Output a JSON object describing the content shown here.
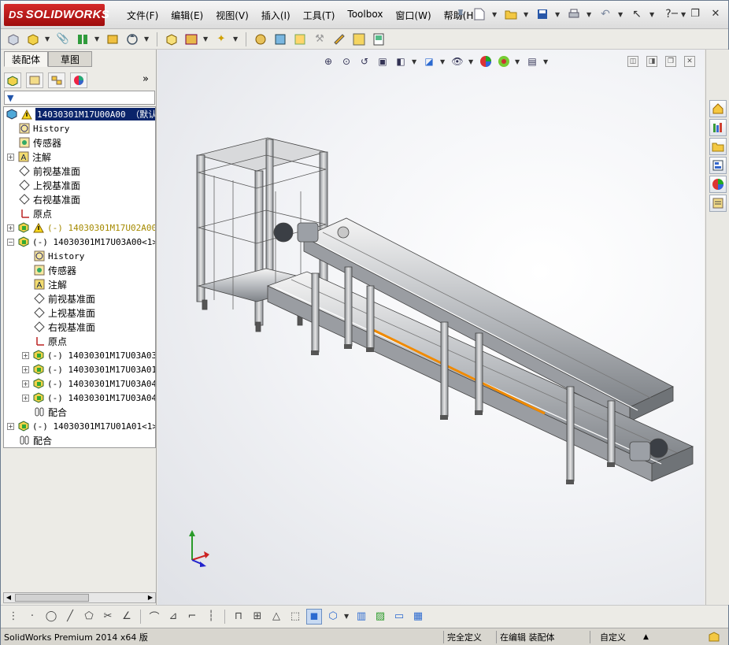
{
  "app": {
    "logo_text": "SOLIDWORKS",
    "logo_prefix": "DS"
  },
  "menu": [
    "文件(F)",
    "编辑(E)",
    "视图(V)",
    "插入(I)",
    "工具(T)",
    "Toolbox",
    "窗口(W)",
    "帮助(H)"
  ],
  "left_pane": {
    "tabs": [
      "装配体",
      "草图"
    ],
    "active_tab": "草图",
    "more_label": "»"
  },
  "tree": {
    "root": "14030301M17U00A00 （默认<",
    "items": {
      "history1": "History",
      "sensors1": "传感器",
      "annotations1": "注解",
      "front_plane1": "前视基准面",
      "top_plane1": "上视基准面",
      "right_plane1": "右视基准面",
      "origin1": "原点",
      "sub_u02": "(-) 14030301M17U02A00<1",
      "sub_u03": "(-) 14030301M17U03A00<1>",
      "history2": "History",
      "sensors2": "传感器",
      "annotations2": "注解",
      "front_plane2": "前视基准面",
      "top_plane2": "上视基准面",
      "right_plane2": "右视基准面",
      "origin2": "原点",
      "part_a03": "(-) 14030301M17U03A03<",
      "part_a01": "(-) 14030301M17U03A01<",
      "part_a04a": "(-) 14030301M17U03A04<",
      "part_a04b": "(-) 14030301M17U03A04<",
      "mates2": "配合",
      "sub_u01": "(-) 14030301M17U01A01<1>",
      "mates1": "配合"
    }
  },
  "status": {
    "product": "SolidWorks Premium 2014 x64 版",
    "definition": "完全定义",
    "editing": "在编辑 装配体",
    "units": "自定义"
  },
  "colors": {
    "logo_red": "#c41c1c",
    "tree_highlight": "#0a246a",
    "warning": "#e0b000",
    "belt_orange": "#f08a00"
  }
}
